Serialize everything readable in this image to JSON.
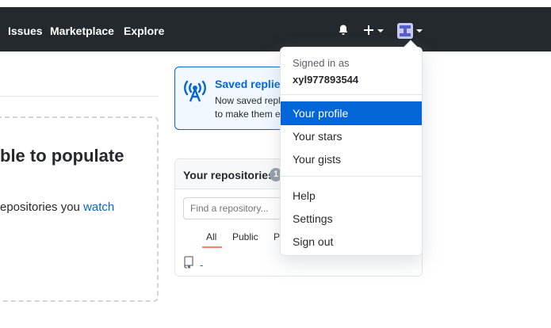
{
  "header": {
    "nav": [
      "Issues",
      "Marketplace",
      "Explore"
    ],
    "icons": {
      "notifications": "bell-icon",
      "create": "plus-icon",
      "avatar": "avatar"
    }
  },
  "dashboard": {
    "heading_fragment": "ble to populate",
    "text_fragment": "epositories you ",
    "text_link": "watch"
  },
  "saved_replies": {
    "title": "Saved replies",
    "line1": "Now saved repli",
    "line2": "to make them e"
  },
  "repositories": {
    "title": "Your repositories",
    "count": "1",
    "find_placeholder": "Find a repository...",
    "tabs": [
      "All",
      "Public",
      "Pr"
    ],
    "active_tab": "All",
    "items": [
      "-"
    ]
  },
  "user_menu": {
    "signed_in_label": "Signed in as",
    "username": "xyl977893544",
    "items_group1": [
      "Your profile",
      "Your stars",
      "Your gists"
    ],
    "items_group2": [
      "Help",
      "Settings",
      "Sign out"
    ],
    "highlighted": "Your profile"
  },
  "colors": {
    "header_bg": "#24292e",
    "link": "#0366d6",
    "highlight": "#0366d6",
    "tab_underline": "#f9826c"
  }
}
